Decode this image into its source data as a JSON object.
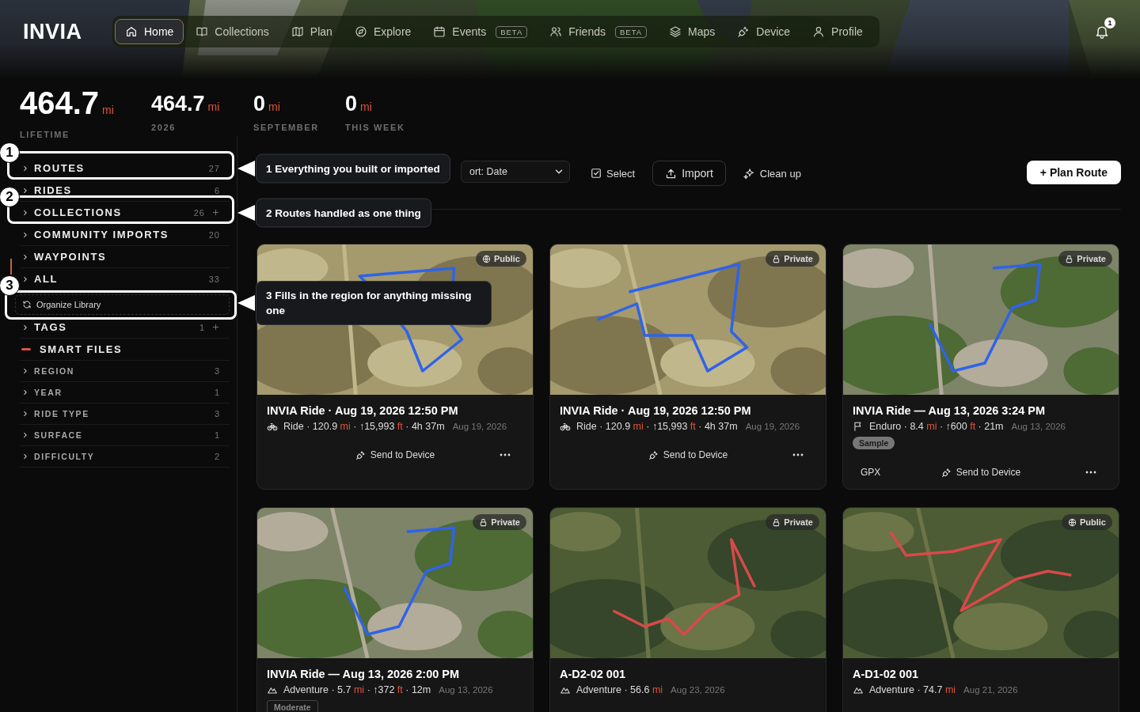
{
  "header": {
    "logo": "INVIA",
    "nav": [
      {
        "label": "Home",
        "selected": true
      },
      {
        "label": "Collections",
        "selected": false
      },
      {
        "label": "Plan",
        "selected": false
      },
      {
        "label": "Explore",
        "selected": false
      },
      {
        "label": "Events",
        "badge": "BETA",
        "selected": false
      },
      {
        "label": "Friends",
        "badge": "BETA",
        "selected": false
      },
      {
        "label": "Maps",
        "selected": false
      },
      {
        "label": "Device",
        "selected": false
      },
      {
        "label": "Profile",
        "selected": false
      }
    ],
    "notifications": {
      "count": "1"
    }
  },
  "stats": [
    {
      "value": "464.7",
      "unit": "mi",
      "label": "LIFETIME",
      "kind": "primary"
    },
    {
      "value": "464.7",
      "unit": "mi",
      "label": "2026",
      "kind": "secondary"
    },
    {
      "value": "0",
      "unit": "mi",
      "label": "SEPTEMBER",
      "kind": "secondary"
    },
    {
      "value": "0",
      "unit": "mi",
      "label": "THIS WEEK",
      "kind": "secondary"
    }
  ],
  "sidebar": {
    "items": [
      {
        "label": "ROUTES",
        "count": "27",
        "kind": "section",
        "expanded": false,
        "selected": false,
        "tour": {
          "badge": "1",
          "callout": "1 Everything you built or imported"
        }
      },
      {
        "label": "RIDES",
        "count": "6",
        "kind": "section",
        "expanded": false,
        "selected": false
      },
      {
        "label": "COLLECTIONS",
        "count": "26",
        "kind": "section",
        "addable": true,
        "expanded": false,
        "selected": false,
        "tour": {
          "badge": "2",
          "callout": "2 Routes handled as one thing"
        }
      },
      {
        "label": "COMMUNITY IMPORTS",
        "count": "20",
        "kind": "section",
        "expanded": false,
        "selected": false
      },
      {
        "label": "WAYPOINTS",
        "kind": "section",
        "expanded": false,
        "selected": false
      },
      {
        "label": "ALL",
        "count": "33",
        "kind": "section",
        "expanded": false,
        "selected": true
      },
      {
        "label": "Organize Library",
        "kind": "action",
        "tour": {
          "badge": "3",
          "callout": "3 Fills in the region for anything missing one"
        }
      },
      {
        "label": "TAGS",
        "count": "1",
        "kind": "section",
        "addable": true,
        "expanded": false,
        "selected": false
      },
      {
        "label": "SMART FILES",
        "kind": "section",
        "expanded": true,
        "selected": false,
        "children": [
          {
            "label": "REGION",
            "count": "3",
            "expanded": false,
            "selected": false
          },
          {
            "label": "YEAR",
            "count": "1",
            "expanded": false,
            "selected": false
          },
          {
            "label": "RIDE TYPE",
            "count": "3",
            "expanded": false,
            "selected": false
          },
          {
            "label": "SURFACE",
            "count": "1",
            "expanded": false,
            "selected": false
          },
          {
            "label": "DIFFICULTY",
            "count": "2",
            "expanded": false,
            "selected": false
          }
        ]
      }
    ]
  },
  "toolbar": {
    "sort": {
      "value": "ort: Date"
    },
    "select": "Select",
    "import": "Import",
    "cleanup": "Clean up",
    "plan_route": "+ Plan Route"
  },
  "cards": [
    {
      "title": "INVIA Ride · Aug 19, 2026 12:50 PM",
      "privacy": {
        "label": "Public",
        "kind": "public"
      },
      "kind": "ride",
      "stats": [
        {
          "text": "Ride · 120.9 "
        },
        {
          "text": "mi",
          "kind": "unit"
        },
        {
          "text": " · ↑15,993 "
        },
        {
          "text": "ft",
          "kind": "unit"
        },
        {
          "text": " · 4h 37m"
        }
      ],
      "date": "Aug 19, 2026",
      "send": "Send to Device"
    },
    {
      "title": "INVIA Ride · Aug 19, 2026 12:50 PM",
      "privacy": {
        "label": "Private",
        "kind": "private"
      },
      "kind": "ride",
      "stats": [
        {
          "text": "Ride · 120.9 "
        },
        {
          "text": "mi",
          "kind": "unit"
        },
        {
          "text": " · ↑15,993 "
        },
        {
          "text": "ft",
          "kind": "unit"
        },
        {
          "text": " · 4h 37m"
        }
      ],
      "date": "Aug 19, 2026",
      "send": "Send to Device"
    },
    {
      "title": "INVIA Ride — Aug 13, 2026 3:24 PM",
      "privacy": {
        "label": "Private",
        "kind": "private"
      },
      "kind": "enduro",
      "stats": [
        {
          "text": "Enduro · 8.4 "
        },
        {
          "text": "mi",
          "kind": "unit"
        },
        {
          "text": " · ↑600 "
        },
        {
          "text": "ft",
          "kind": "unit"
        },
        {
          "text": " · 21m"
        }
      ],
      "date": "Aug 13, 2026",
      "tags": [
        {
          "label": "Sample",
          "kind": "filled"
        }
      ],
      "format": "GPX",
      "send": "Send to Device"
    },
    {
      "title": "INVIA Ride — Aug 13, 2026 2:00 PM",
      "privacy": {
        "label": "Private",
        "kind": "private"
      },
      "kind": "adventure",
      "stats": [
        {
          "text": "Adventure · 5.7 "
        },
        {
          "text": "mi",
          "kind": "unit"
        },
        {
          "text": " · ↑372 "
        },
        {
          "text": "ft",
          "kind": "unit"
        },
        {
          "text": " · 12m"
        }
      ],
      "date": "Aug 13, 2026",
      "tags": [
        {
          "label": "Moderate",
          "kind": "outline"
        }
      ]
    },
    {
      "title": "A-D2-02 001",
      "privacy": {
        "label": "Private",
        "kind": "private"
      },
      "kind": "adventure",
      "stats": [
        {
          "text": "Adventure · 56.6 "
        },
        {
          "text": "mi",
          "kind": "unit"
        }
      ],
      "date": "Aug 23, 2026"
    },
    {
      "title": "A-D1-02 001",
      "privacy": {
        "label": "Public",
        "kind": "public"
      },
      "kind": "adventure",
      "stats": [
        {
          "text": "Adventure · 74.7 "
        },
        {
          "text": "mi",
          "kind": "unit"
        }
      ],
      "date": "Aug 21, 2026"
    }
  ]
}
